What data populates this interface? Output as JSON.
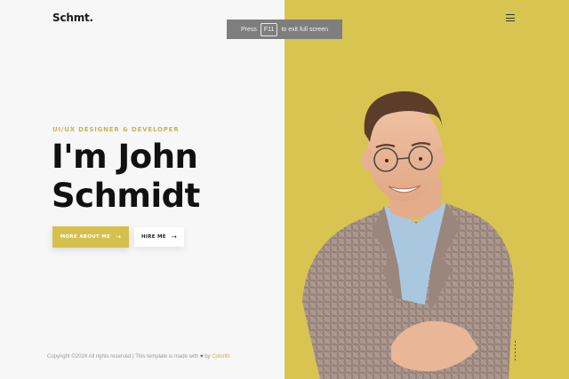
{
  "header": {
    "logo": "Schmt."
  },
  "fullscreen_notice": {
    "prefix": "Press",
    "key": "F11",
    "suffix": "to exit full screen"
  },
  "hero": {
    "eyebrow": "UI/UX DESIGNER & DEVELOPER",
    "title_line1": "I'm John",
    "title_line2": "Schmidt",
    "primary_button": "MORE ABOUT ME",
    "secondary_button": "HIRE ME",
    "arrow": "→"
  },
  "footer": {
    "text": "Copyright ©2024 All rights reserved | This template is made with",
    "heart": "♥",
    "by": "by",
    "link": "Colorlib"
  },
  "icons": {
    "menu": "hamburger-menu-icon",
    "heart": "heart-icon",
    "arrow": "arrow-right-icon"
  },
  "colors": {
    "accent": "#d8c451",
    "background": "#f7f7f7",
    "text": "#111111"
  }
}
